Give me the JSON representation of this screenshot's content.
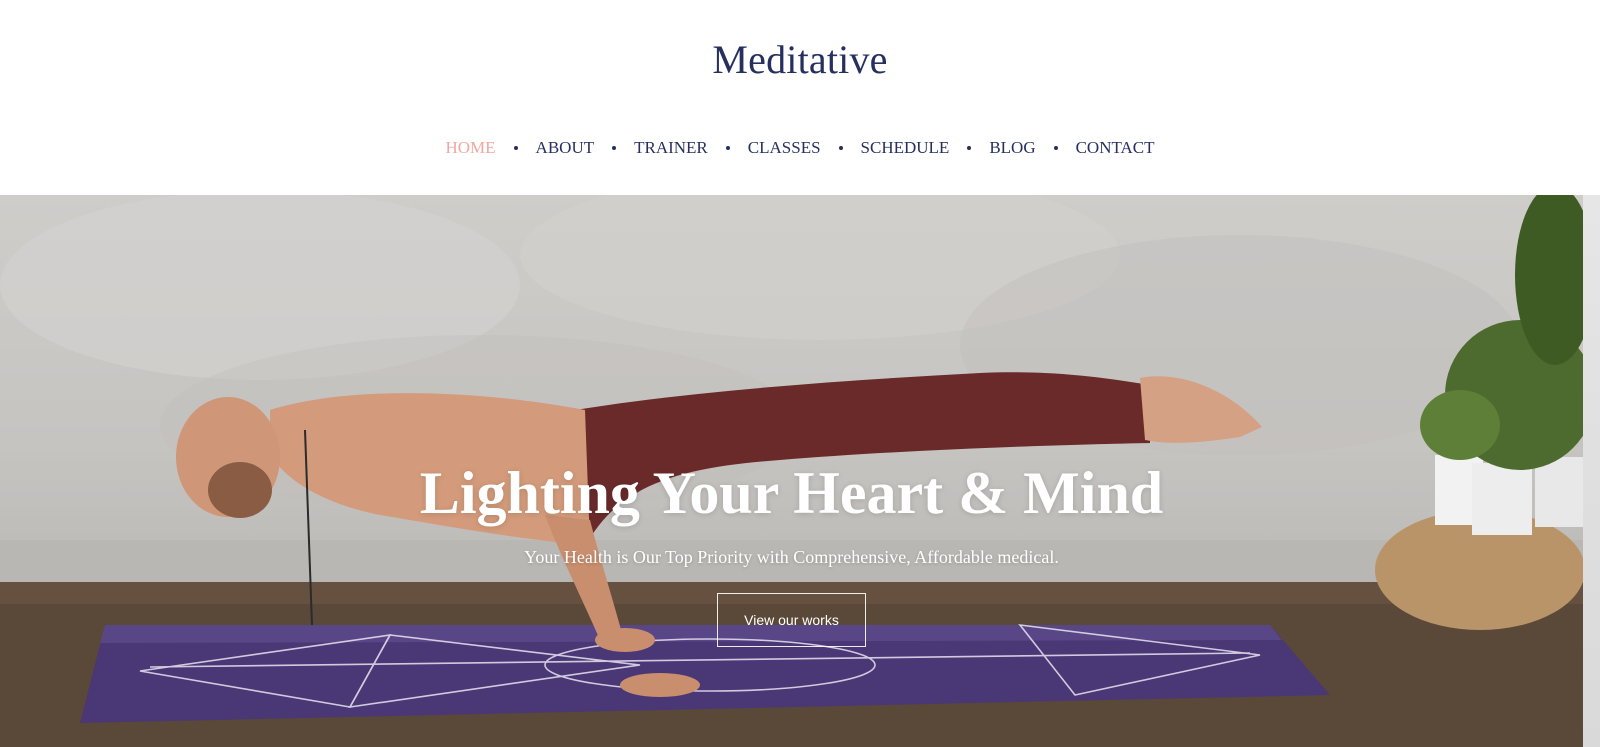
{
  "site": {
    "logo": "Meditative"
  },
  "nav": {
    "items": [
      {
        "label": "HOME",
        "active": true
      },
      {
        "label": "ABOUT",
        "active": false
      },
      {
        "label": "TRAINER",
        "active": false
      },
      {
        "label": "CLASSES",
        "active": false
      },
      {
        "label": "SCHEDULE",
        "active": false
      },
      {
        "label": "BLOG",
        "active": false
      },
      {
        "label": "CONTACT",
        "active": false
      }
    ]
  },
  "hero": {
    "title": "Lighting Your Heart & Mind",
    "subtitle": "Your Health is Our Top Priority with Comprehensive, Affordable medical.",
    "button_label": "View our works"
  },
  "colors": {
    "brand_navy": "#26305f",
    "accent_pink": "#f1a7a1",
    "white": "#ffffff"
  }
}
